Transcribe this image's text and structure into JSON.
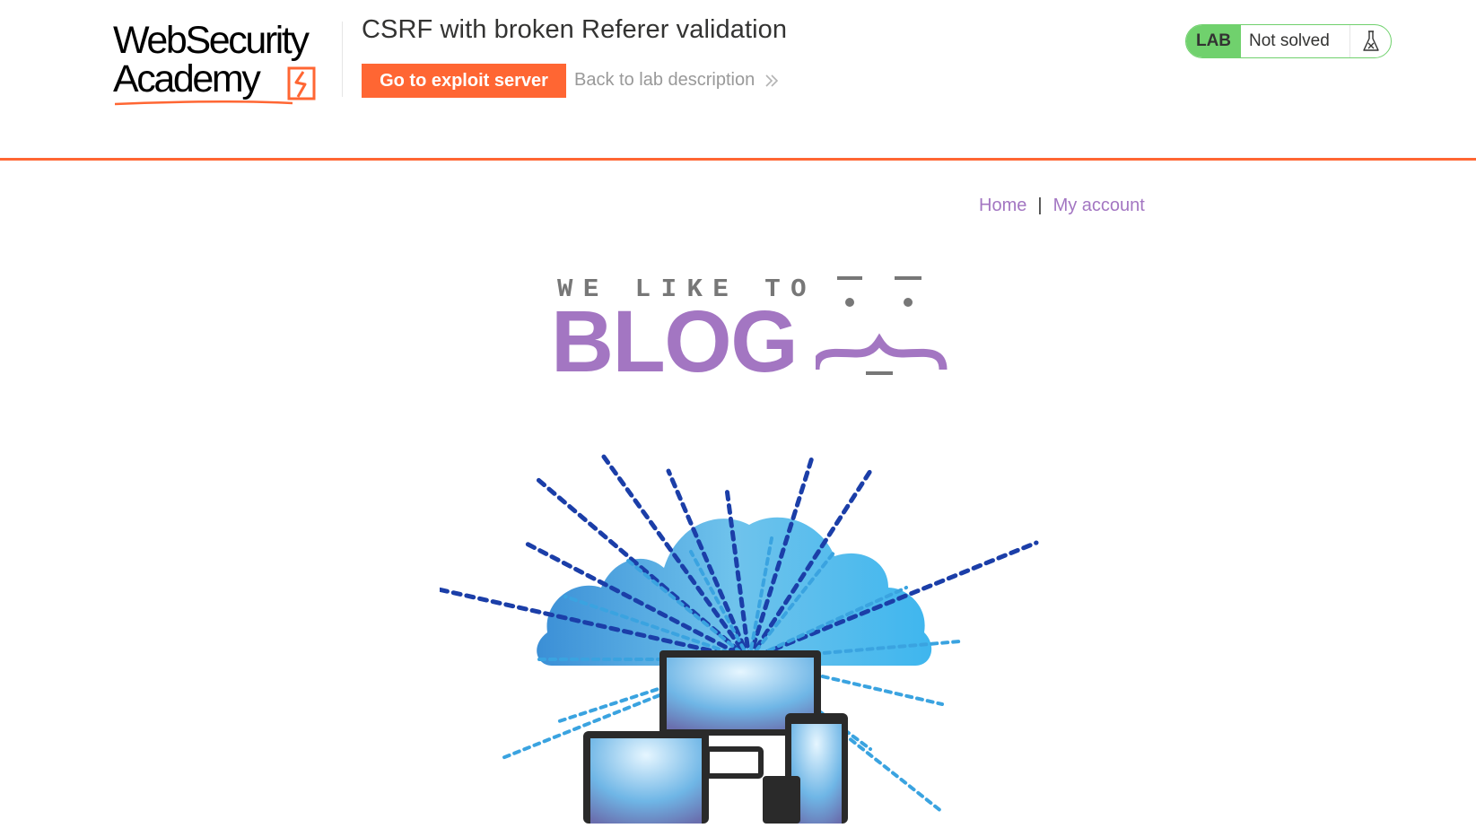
{
  "header": {
    "logo_line1": "WebSecurity",
    "logo_line2": "Academy",
    "lab_title": "CSRF with broken Referer validation",
    "exploit_button": "Go to exploit server",
    "back_link": "Back to lab description",
    "lab_badge": "LAB",
    "lab_status": "Not solved",
    "colors": {
      "accent": "#ff6633",
      "lab_green": "#70d16d",
      "blog_purple": "#a376c2"
    }
  },
  "nav": {
    "home": "Home",
    "separator": "|",
    "my_account": "My account"
  },
  "blog": {
    "tagline": "WE LIKE TO",
    "word": "BLOG"
  },
  "icons": {
    "logo_mark": "academy-logo-icon",
    "back_chevrons": "double-chevron-right-icon",
    "flask": "flask-icon",
    "face": "blog-face-icon",
    "hero": "cloud-binary-devices-image"
  }
}
